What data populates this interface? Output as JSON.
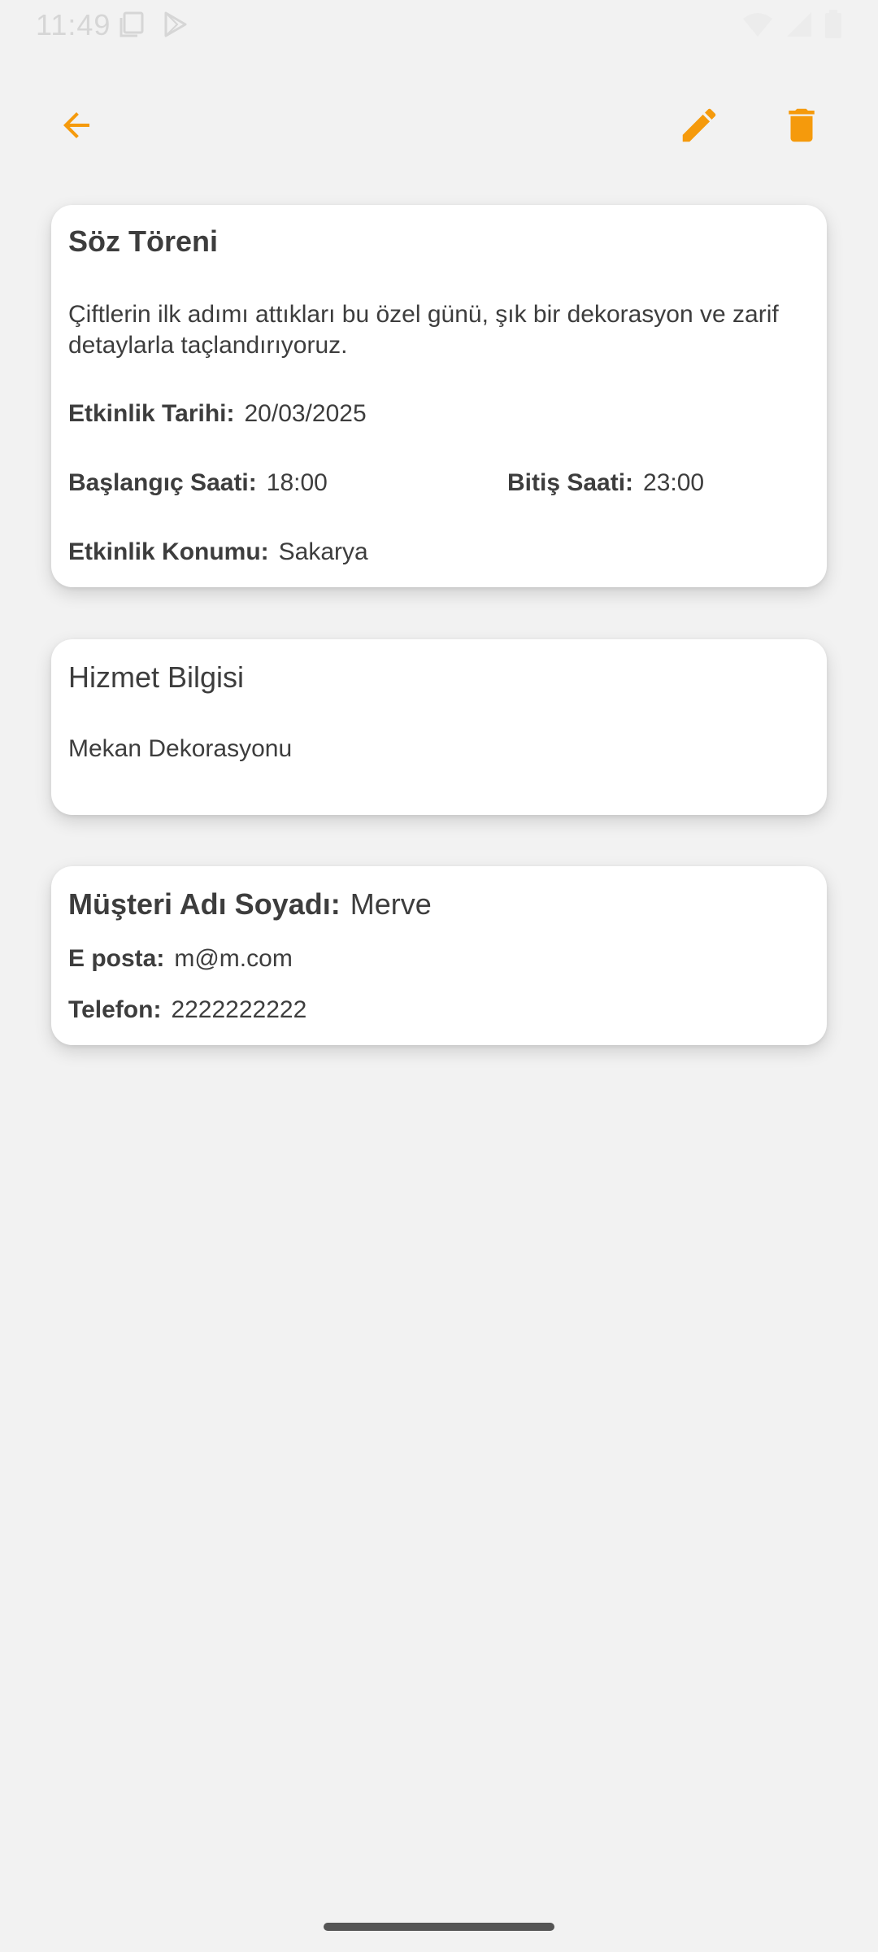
{
  "status_bar": {
    "time": "11:49",
    "left_icons": [
      "screenshot-icon",
      "play-store-icon"
    ],
    "right_icons": [
      "wifi-icon",
      "signal-icon",
      "battery-icon"
    ]
  },
  "app_bar": {
    "accent_color": "#F59A0C",
    "icons": [
      "back-arrow-icon",
      "edit-pencil-icon",
      "delete-trash-icon"
    ]
  },
  "event": {
    "title": "Söz Töreni",
    "description": "Çiftlerin ilk adımı attıkları bu özel günü, şık bir dekorasyon ve zarif detaylarla taçlandırıyoruz.",
    "date_label": "Etkinlik Tarihi:",
    "date_value": "20/03/2025",
    "start_label": "Başlangıç Saati:",
    "start_value": "18:00",
    "end_label": "Bitiş Saati:",
    "end_value": "23:00",
    "location_label": "Etkinlik Konumu:",
    "location_value": "Sakarya"
  },
  "service": {
    "title": "Hizmet Bilgisi",
    "value": "Mekan Dekorasyonu"
  },
  "customer": {
    "name_label": "Müşteri Adı Soyadı:",
    "name_value": "Merve",
    "email_label": "E posta:",
    "email_value": "m@m.com",
    "phone_label": "Telefon:",
    "phone_value": "2222222222"
  }
}
